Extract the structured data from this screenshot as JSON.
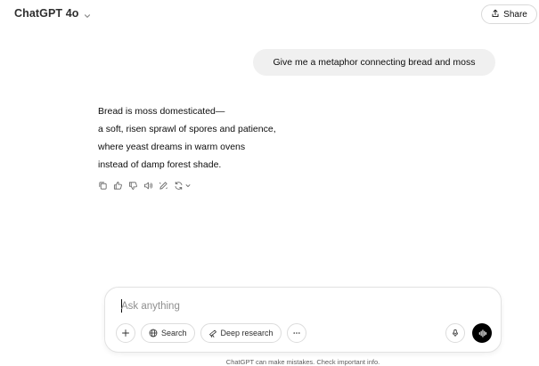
{
  "header": {
    "model_name": "ChatGPT 4o",
    "share_label": "Share"
  },
  "conversation": {
    "user_message": "Give me a metaphor connecting bread and moss",
    "assistant_lines": [
      "Bread is moss domesticated—",
      "a soft, risen sprawl of spores and patience,",
      "where yeast dreams in warm ovens",
      "instead of damp forest shade."
    ],
    "action_icons": [
      "copy-icon",
      "thumbs-up-icon",
      "thumbs-down-icon",
      "read-aloud-icon",
      "edit-icon",
      "regenerate-icon",
      "chevron-down-icon"
    ]
  },
  "composer": {
    "placeholder": "Ask anything",
    "value": "",
    "tools": {
      "search_label": "Search",
      "deep_research_label": "Deep research"
    }
  },
  "footer": {
    "disclaimer": "ChatGPT can make mistakes. Check important info."
  },
  "colors": {
    "user_bubble": "#f0f0f0",
    "voice_button": "#000000",
    "text": "#0d0d0d"
  }
}
